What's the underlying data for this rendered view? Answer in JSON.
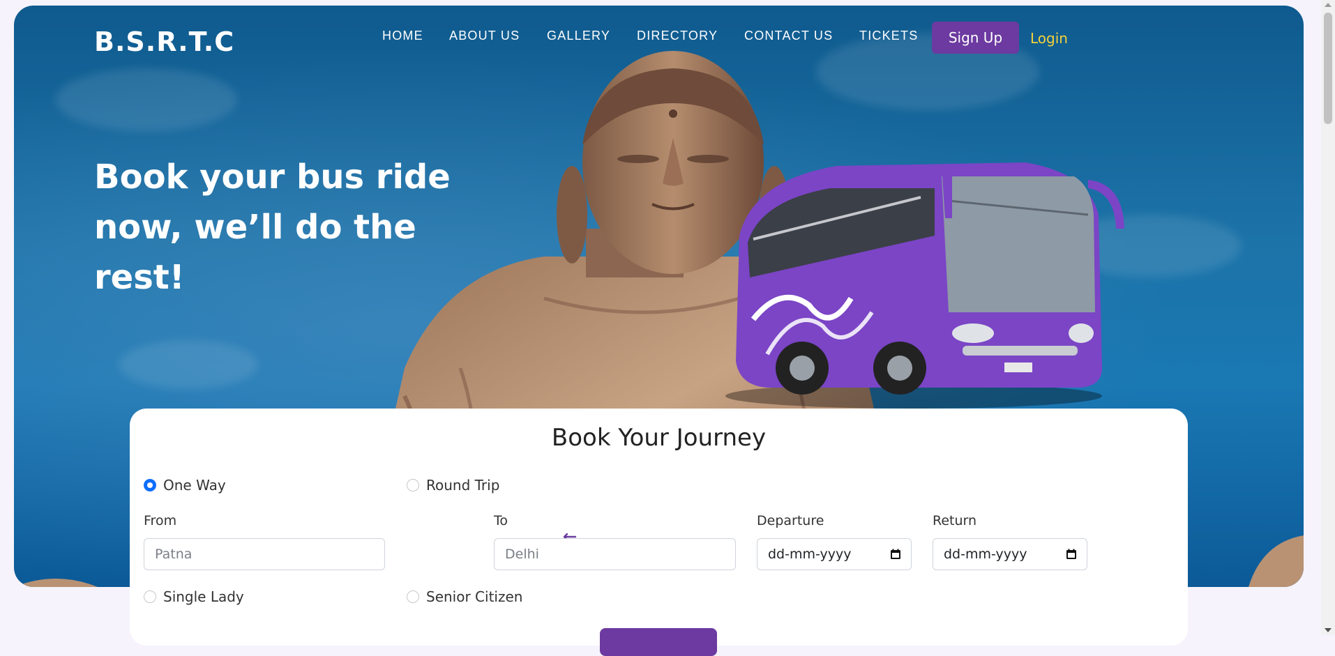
{
  "brand": "B.S.R.T.C",
  "nav": {
    "items": [
      "HOME",
      "ABOUT US",
      "GALLERY",
      "DIRECTORY",
      "CONTACT US",
      "TICKETS"
    ],
    "signup_label": "Sign Up",
    "login_label": "Login"
  },
  "hero": {
    "headline_line1": "Book your bus ride",
    "headline_line2": "now, we’ll do the rest!"
  },
  "booking": {
    "title": "Book Your Journey",
    "trip_types": [
      "One Way",
      "Round Trip"
    ],
    "selected_trip_type": "One Way",
    "from_label": "From",
    "from_placeholder": "Patna",
    "to_label": "To",
    "to_placeholder": "Delhi",
    "departure_label": "Departure",
    "departure_value": "dd-mm-yyyy",
    "return_label": "Return",
    "return_value": "dd-mm-yyyy",
    "options": [
      "Single Lady",
      "Senior Citizen"
    ]
  },
  "colors": {
    "accent": "#6c3aa0",
    "login": "#f3d23a",
    "radio_selected": "#0d6efd"
  },
  "icons": {
    "swap": "swap-arrows-icon",
    "calendar": "calendar-icon"
  }
}
